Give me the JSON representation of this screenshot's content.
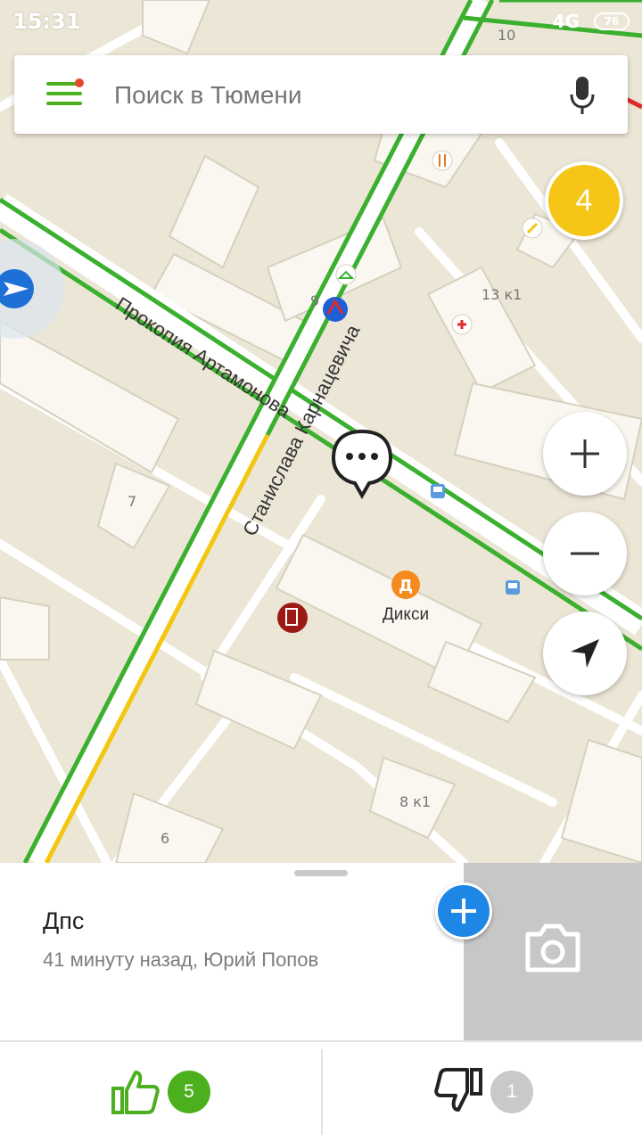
{
  "status_bar": {
    "time": "15:31",
    "network": "4G",
    "battery": "76"
  },
  "search": {
    "placeholder": "Поиск в Тюмени"
  },
  "map": {
    "streets": [
      "Прокопия Артамонова",
      "Станислава Карнацевича"
    ],
    "poi": [
      "Дикси"
    ],
    "poi_letter": "Д",
    "house_numbers": [
      "9",
      "7",
      "13 к1",
      "8 к1",
      "6",
      "10"
    ],
    "events_count": "4"
  },
  "event": {
    "title": "Дпс",
    "subtitle": "41 минуту назад, Юрий Попов",
    "likes": "5",
    "dislikes": "1"
  },
  "colors": {
    "accent_green": "#4caf1e",
    "yellow": "#f5c518",
    "blue": "#1e86e5"
  },
  "icons": [
    "menu-icon",
    "microphone-icon",
    "plus-icon",
    "minus-icon",
    "locate-arrow-icon",
    "camera-icon",
    "thumbs-up-icon",
    "thumbs-down-icon",
    "chat-bubble-icon",
    "bus-stop-icon"
  ]
}
